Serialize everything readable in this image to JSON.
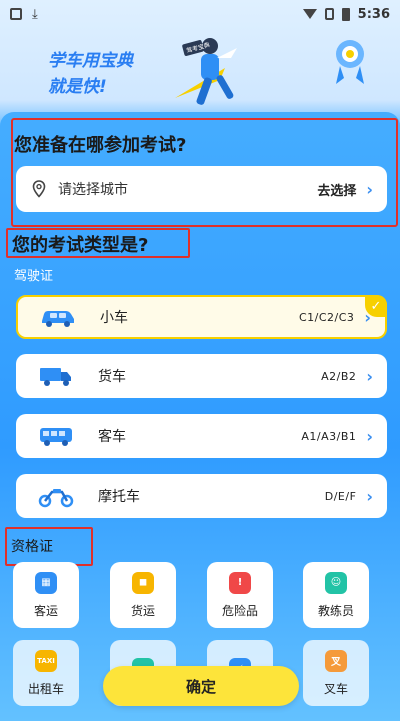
{
  "status_bar": {
    "time": "5:36"
  },
  "hero": {
    "slogan_line1": "学车用宝典",
    "slogan_line2": "就是快!",
    "badge_text": "驾考宝典"
  },
  "exam_location": {
    "question": "您准备在哪参加考试?",
    "placeholder": "请选择城市",
    "action": "去选择"
  },
  "exam_type": {
    "question": "您的考试类型是?",
    "license_section": "驾驶证",
    "vehicles": [
      {
        "name": "小车",
        "code": "C1/C2/C3",
        "icon": "car-icon",
        "selected": true
      },
      {
        "name": "货车",
        "code": "A2/B2",
        "icon": "truck-icon",
        "selected": false
      },
      {
        "name": "客车",
        "code": "A1/A3/B1",
        "icon": "bus-icon",
        "selected": false
      },
      {
        "name": "摩托车",
        "code": "D/E/F",
        "icon": "motorcycle-icon",
        "selected": false
      }
    ],
    "qualification_section": "资格证",
    "certificates": [
      {
        "label": "客运",
        "icon": "passenger-bus-icon",
        "color": "#2f8ff5"
      },
      {
        "label": "货运",
        "icon": "freight-icon",
        "color": "#f7b500"
      },
      {
        "label": "危险品",
        "icon": "hazard-icon",
        "color": "#f04848"
      },
      {
        "label": "教练员",
        "icon": "instructor-icon",
        "color": "#22c3a6"
      },
      {
        "label": "出租车",
        "icon": "taxi-icon",
        "color": "#f7b500",
        "icon_text": "TAXI"
      },
      {
        "label": "",
        "icon": "ride-hailing-icon",
        "color": "#22c3a6"
      },
      {
        "label": "",
        "icon": "charging-icon",
        "color": "#2f8ff5"
      },
      {
        "label": "叉车",
        "icon": "forklift-icon",
        "color": "#f59a3a",
        "icon_text": "叉"
      }
    ]
  },
  "confirm_label": "确定",
  "colors": {
    "accent_yellow": "#fde43a",
    "brand_blue": "#2f9bff",
    "highlight_red": "#e0302a"
  }
}
